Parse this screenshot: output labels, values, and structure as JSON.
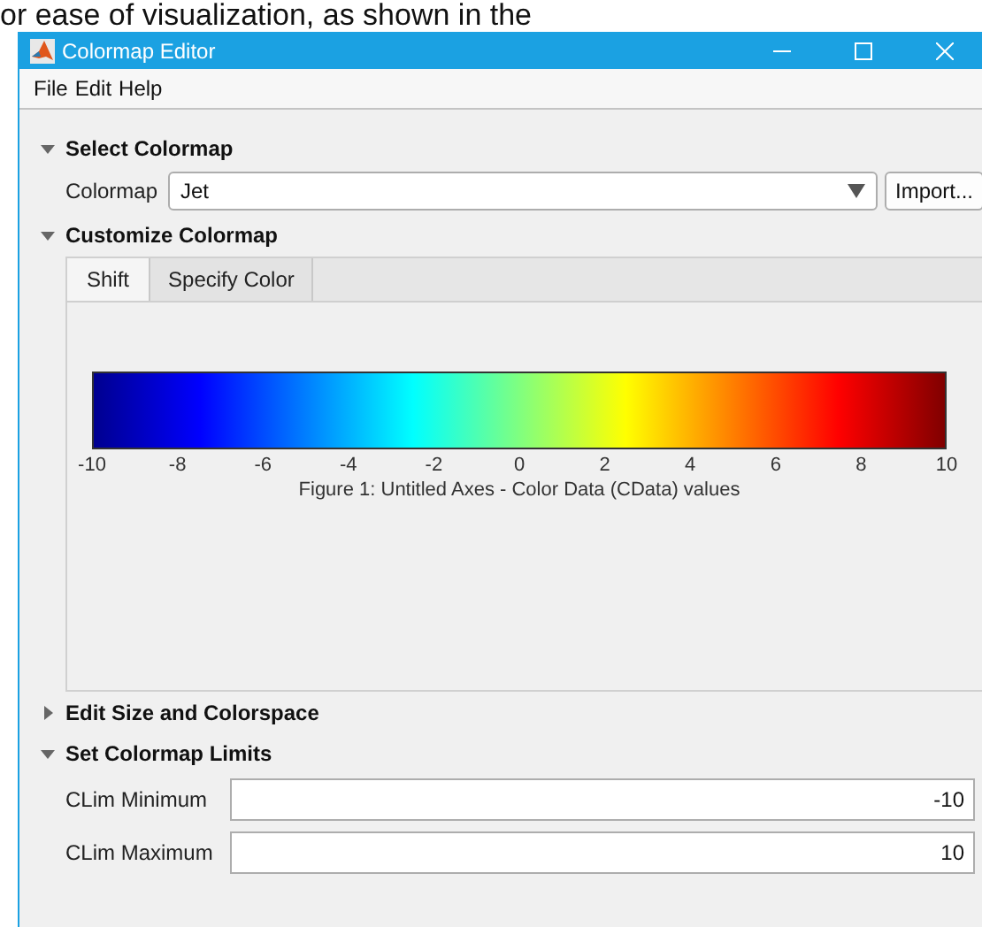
{
  "backdrop_text": "or ease of visualization, as shown in the",
  "window": {
    "title": "Colormap Editor"
  },
  "menu": [
    "File",
    "Edit",
    "Help"
  ],
  "sections": [
    {
      "title": "Select Colormap",
      "expanded": true,
      "kind": "select",
      "label": "Colormap",
      "value": "Jet",
      "button": "Import..."
    },
    {
      "title": "Customize Colormap",
      "expanded": true,
      "kind": "tabs",
      "tabs": [
        {
          "label": "Shift",
          "selected": true
        },
        {
          "label": "Specify Color",
          "selected": false
        }
      ],
      "colorbar": {
        "ticks": [
          "-10",
          "-8",
          "-6",
          "-4",
          "-2",
          "0",
          "2",
          "4",
          "6",
          "8",
          "10"
        ],
        "caption": "Figure 1: Untitled Axes - Color Data (CData) values"
      }
    },
    {
      "title": "Edit Size and Colorspace",
      "expanded": false
    },
    {
      "title": "Set Colormap Limits",
      "expanded": true,
      "kind": "fields",
      "fields": [
        {
          "label": "CLim Minimum",
          "value": "-10"
        },
        {
          "label": "CLim Maximum",
          "value": "10"
        }
      ]
    }
  ]
}
